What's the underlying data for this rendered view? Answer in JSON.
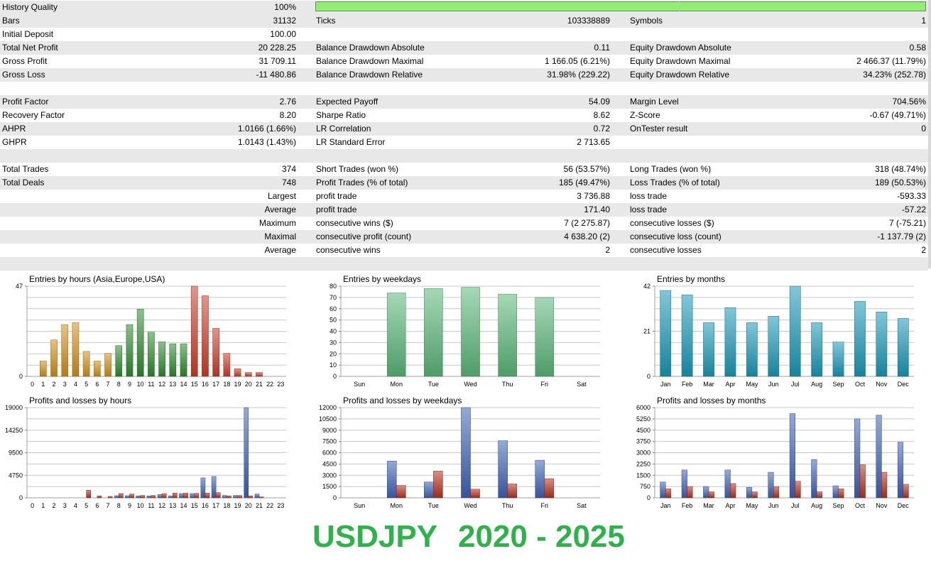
{
  "history_quality": {
    "label": "History Quality",
    "value": "100%"
  },
  "stats_rows": [
    {
      "shaded": true,
      "c1l": "Bars",
      "c1v": "31132",
      "c2l": "Ticks",
      "c2v": "103338889",
      "c3l": "Symbols",
      "c3v": "1"
    },
    {
      "shaded": false,
      "c1l": "Initial Deposit",
      "c1v": "100.00",
      "c2l": "",
      "c2v": "",
      "c3l": "",
      "c3v": ""
    },
    {
      "shaded": true,
      "c1l": "Total Net Profit",
      "c1v": "20 228.25",
      "c2l": "Balance Drawdown Absolute",
      "c2v": "0.11",
      "c3l": "Equity Drawdown Absolute",
      "c3v": "0.58"
    },
    {
      "shaded": false,
      "c1l": "Gross Profit",
      "c1v": "31 709.11",
      "c2l": "Balance Drawdown Maximal",
      "c2v": "1 166.05 (6.21%)",
      "c3l": "Equity Drawdown Maximal",
      "c3v": "2 466.37 (11.79%)"
    },
    {
      "shaded": true,
      "c1l": "Gross Loss",
      "c1v": "-11 480.86",
      "c2l": "Balance Drawdown Relative",
      "c2v": "31.98% (229.22)",
      "c3l": "Equity Drawdown Relative",
      "c3v": "34.23% (252.78)"
    },
    {
      "shaded": false,
      "c1l": "",
      "c1v": "",
      "c2l": "",
      "c2v": "",
      "c3l": "",
      "c3v": ""
    },
    {
      "shaded": true,
      "c1l": "Profit Factor",
      "c1v": "2.76",
      "c2l": "Expected Payoff",
      "c2v": "54.09",
      "c3l": "Margin Level",
      "c3v": "704.56%"
    },
    {
      "shaded": false,
      "c1l": "Recovery Factor",
      "c1v": "8.20",
      "c2l": "Sharpe Ratio",
      "c2v": "8.62",
      "c3l": "Z-Score",
      "c3v": "-0.67 (49.71%)"
    },
    {
      "shaded": true,
      "c1l": "AHPR",
      "c1v": "1.0166 (1.66%)",
      "c2l": "LR Correlation",
      "c2v": "0.72",
      "c3l": "OnTester result",
      "c3v": "0"
    },
    {
      "shaded": false,
      "c1l": "GHPR",
      "c1v": "1.0143 (1.43%)",
      "c2l": "LR Standard Error",
      "c2v": "2 713.65",
      "c3l": "",
      "c3v": ""
    },
    {
      "shaded": true,
      "c1l": "",
      "c1v": "",
      "c2l": "",
      "c2v": "",
      "c3l": "",
      "c3v": ""
    },
    {
      "shaded": false,
      "c1l": "Total Trades",
      "c1v": "374",
      "c2l": "Short Trades (won %)",
      "c2v": "56 (53.57%)",
      "c3l": "Long Trades (won %)",
      "c3v": "318 (48.74%)"
    },
    {
      "shaded": true,
      "c1l": "Total Deals",
      "c1v": "748",
      "c2l": "Profit Trades (% of total)",
      "c2v": "185 (49.47%)",
      "c3l": "Loss Trades (% of total)",
      "c3v": "189 (50.53%)"
    },
    {
      "shaded": false,
      "c1l": "",
      "c1v": "Largest",
      "c2l": "profit trade",
      "c2v": "3 736.88",
      "c3l": "loss trade",
      "c3v": "-593.33"
    },
    {
      "shaded": true,
      "c1l": "",
      "c1v": "Average",
      "c2l": "profit trade",
      "c2v": "171.40",
      "c3l": "loss trade",
      "c3v": "-57.22"
    },
    {
      "shaded": false,
      "c1l": "",
      "c1v": "Maximum",
      "c2l": "consecutive wins ($)",
      "c2v": "7 (2 275.87)",
      "c3l": "consecutive losses ($)",
      "c3v": "7 (-75.21)"
    },
    {
      "shaded": true,
      "c1l": "",
      "c1v": "Maximal",
      "c2l": "consecutive profit (count)",
      "c2v": "4 638.20 (2)",
      "c3l": "consecutive loss (count)",
      "c3v": "-1 137.79 (2)"
    },
    {
      "shaded": false,
      "c1l": "",
      "c1v": "Average",
      "c2l": "consecutive wins",
      "c2v": "2",
      "c3l": "consecutive losses",
      "c3v": "2"
    },
    {
      "shaded": true,
      "c1l": "",
      "c1v": "",
      "c2l": "",
      "c2v": "",
      "c3l": "",
      "c3v": ""
    }
  ],
  "colors": {
    "session_asia": "#d4901a",
    "session_europe": "#2e8b2e",
    "session_usa": "#d03c28",
    "weekday_bar": "#5cb87a",
    "month_bar": "#1a9ab8",
    "profit": "#3f63b8",
    "loss": "#b8321e",
    "caption": "#2db34a"
  },
  "chart_data": [
    {
      "id": "entries-hours",
      "type": "bar",
      "title": "Entries by hours (Asia,Europe,USA)",
      "categories": [
        "0",
        "1",
        "2",
        "3",
        "4",
        "5",
        "6",
        "7",
        "8",
        "9",
        "10",
        "11",
        "12",
        "13",
        "14",
        "15",
        "16",
        "17",
        "18",
        "19",
        "20",
        "21",
        "22",
        "23"
      ],
      "values": [
        0,
        8,
        19,
        27,
        28,
        13,
        8,
        12,
        16,
        27,
        35,
        23,
        18,
        17,
        17,
        47,
        42,
        25,
        12,
        4,
        2,
        2,
        0,
        0
      ],
      "sessions": [
        "asia",
        "asia",
        "asia",
        "asia",
        "asia",
        "asia",
        "asia",
        "asia",
        "europe",
        "europe",
        "europe",
        "europe",
        "europe",
        "europe",
        "europe",
        "usa",
        "usa",
        "usa",
        "usa",
        "usa",
        "usa",
        "usa",
        "usa",
        "usa"
      ],
      "ylim": [
        0,
        47
      ],
      "yticks": [
        "0",
        "47"
      ]
    },
    {
      "id": "entries-weekdays",
      "type": "bar",
      "title": "Entries by weekdays",
      "categories": [
        "Sun",
        "Mon",
        "Tue",
        "Wed",
        "Thu",
        "Fri",
        "Sat"
      ],
      "values": [
        0,
        74,
        78,
        79,
        73,
        70,
        0
      ],
      "ylim": [
        0,
        80
      ],
      "yticks": [
        "0",
        "10",
        "20",
        "30",
        "40",
        "50",
        "60",
        "70",
        "80"
      ]
    },
    {
      "id": "entries-months",
      "type": "bar",
      "title": "Entries by months",
      "categories": [
        "Jan",
        "Feb",
        "Mar",
        "Apr",
        "May",
        "Jun",
        "Jul",
        "Aug",
        "Sep",
        "Oct",
        "Nov",
        "Dec"
      ],
      "values": [
        40,
        38,
        25,
        32,
        25,
        28,
        42,
        25,
        16,
        35,
        30,
        27
      ],
      "ylim": [
        0,
        42
      ],
      "yticks": [
        "0",
        "21",
        "42"
      ]
    },
    {
      "id": "pl-hours",
      "type": "bar",
      "title": "Profits and losses by hours",
      "categories": [
        "0",
        "1",
        "2",
        "3",
        "4",
        "5",
        "6",
        "7",
        "8",
        "9",
        "10",
        "11",
        "12",
        "13",
        "14",
        "15",
        "16",
        "17",
        "18",
        "19",
        "20",
        "21",
        "22",
        "23"
      ],
      "series": [
        {
          "values": [
            0,
            0,
            0,
            0,
            0,
            0,
            0,
            0,
            450,
            450,
            400,
            400,
            700,
            400,
            900,
            900,
            4200,
            4500,
            500,
            500,
            19000,
            800,
            0,
            0
          ]
        },
        {
          "values": [
            0,
            0,
            0,
            0,
            0,
            1600,
            400,
            300,
            900,
            800,
            500,
            500,
            900,
            1000,
            1000,
            950,
            1000,
            1100,
            400,
            500,
            400,
            200,
            0,
            0
          ]
        }
      ],
      "ylim": [
        0,
        19000
      ],
      "yticks": [
        "0",
        "4750",
        "9500",
        "14250",
        "19000"
      ]
    },
    {
      "id": "pl-weekdays",
      "type": "bar",
      "title": "Profits and losses by weekdays",
      "categories": [
        "Sun",
        "Mon",
        "Tue",
        "Wed",
        "Thu",
        "Fri",
        "Sat"
      ],
      "series": [
        {
          "values": [
            0,
            4900,
            2100,
            12000,
            7600,
            5000,
            0
          ]
        },
        {
          "values": [
            0,
            1650,
            3550,
            1150,
            1850,
            2550,
            0
          ]
        }
      ],
      "ylim": [
        0,
        12000
      ],
      "yticks": [
        "0",
        "1500",
        "3000",
        "4500",
        "6000",
        "7500",
        "9000",
        "10500",
        "12000"
      ]
    },
    {
      "id": "pl-months",
      "type": "bar",
      "title": "Profits and losses by months",
      "categories": [
        "Jan",
        "Feb",
        "Mar",
        "Apr",
        "May",
        "Jun",
        "Jul",
        "Aug",
        "Sep",
        "Oct",
        "Nov",
        "Dec"
      ],
      "series": [
        {
          "values": [
            1050,
            1850,
            750,
            1850,
            700,
            1700,
            5600,
            2550,
            800,
            5250,
            5500,
            3700
          ]
        },
        {
          "values": [
            600,
            750,
            400,
            950,
            400,
            750,
            1100,
            400,
            600,
            2200,
            1700,
            900
          ]
        }
      ],
      "ylim": [
        0,
        6000
      ],
      "yticks": [
        "0",
        "750",
        "1500",
        "2250",
        "3000",
        "3750",
        "4500",
        "5250",
        "6000"
      ]
    }
  ],
  "caption": {
    "left": "USDJPY",
    "right": "2020 - 2025"
  }
}
